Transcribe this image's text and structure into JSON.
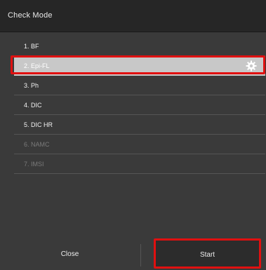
{
  "title": "Check Mode",
  "modes": [
    {
      "label": "1. BF",
      "enabled": true,
      "selected": false
    },
    {
      "label": "2. Epi-FL",
      "enabled": true,
      "selected": true
    },
    {
      "label": "3. Ph",
      "enabled": true,
      "selected": false
    },
    {
      "label": "4. DIC",
      "enabled": true,
      "selected": false
    },
    {
      "label": "5. DIC HR",
      "enabled": true,
      "selected": false
    },
    {
      "label": "6. NAMC",
      "enabled": false,
      "selected": false
    },
    {
      "label": "7. IMSI",
      "enabled": false,
      "selected": false
    }
  ],
  "selected_row_icon": "gear-icon",
  "buttons": {
    "close": "Close",
    "start": "Start"
  },
  "colors": {
    "highlight": "#e01010",
    "selected_row": "#c8c8c8"
  }
}
